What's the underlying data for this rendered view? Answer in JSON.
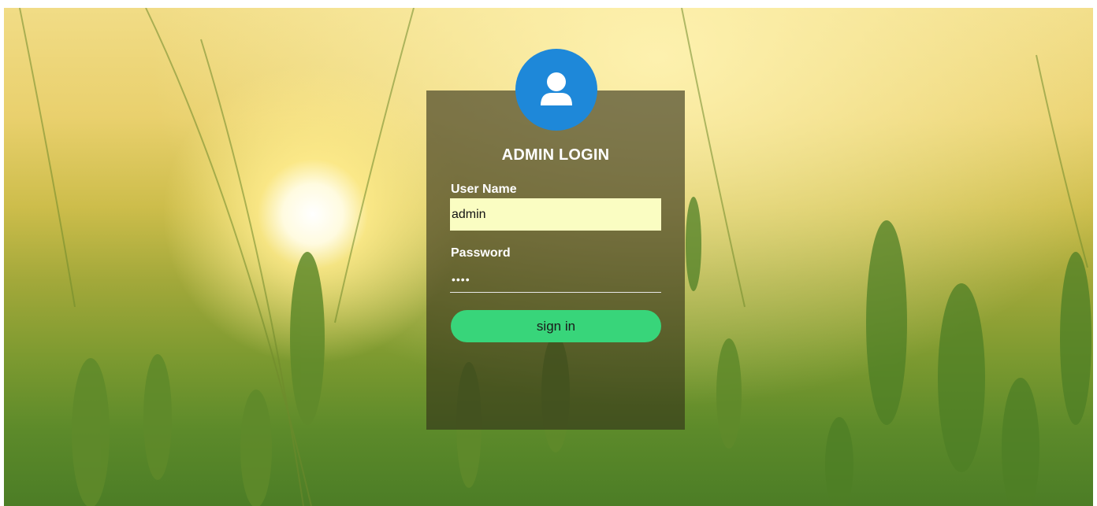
{
  "login": {
    "title": "ADMIN LOGIN",
    "username_label": "User Name",
    "username_value": "admin",
    "password_label": "Password",
    "password_value": "abcd",
    "signin_label": "sign in"
  },
  "icons": {
    "avatar": "user-icon"
  },
  "colors": {
    "avatar_bg": "#1e88d9",
    "signin_bg": "#38d57a",
    "username_field_bg": "#fafdc2",
    "card_overlay": "rgba(50,48,24,0.62)"
  }
}
